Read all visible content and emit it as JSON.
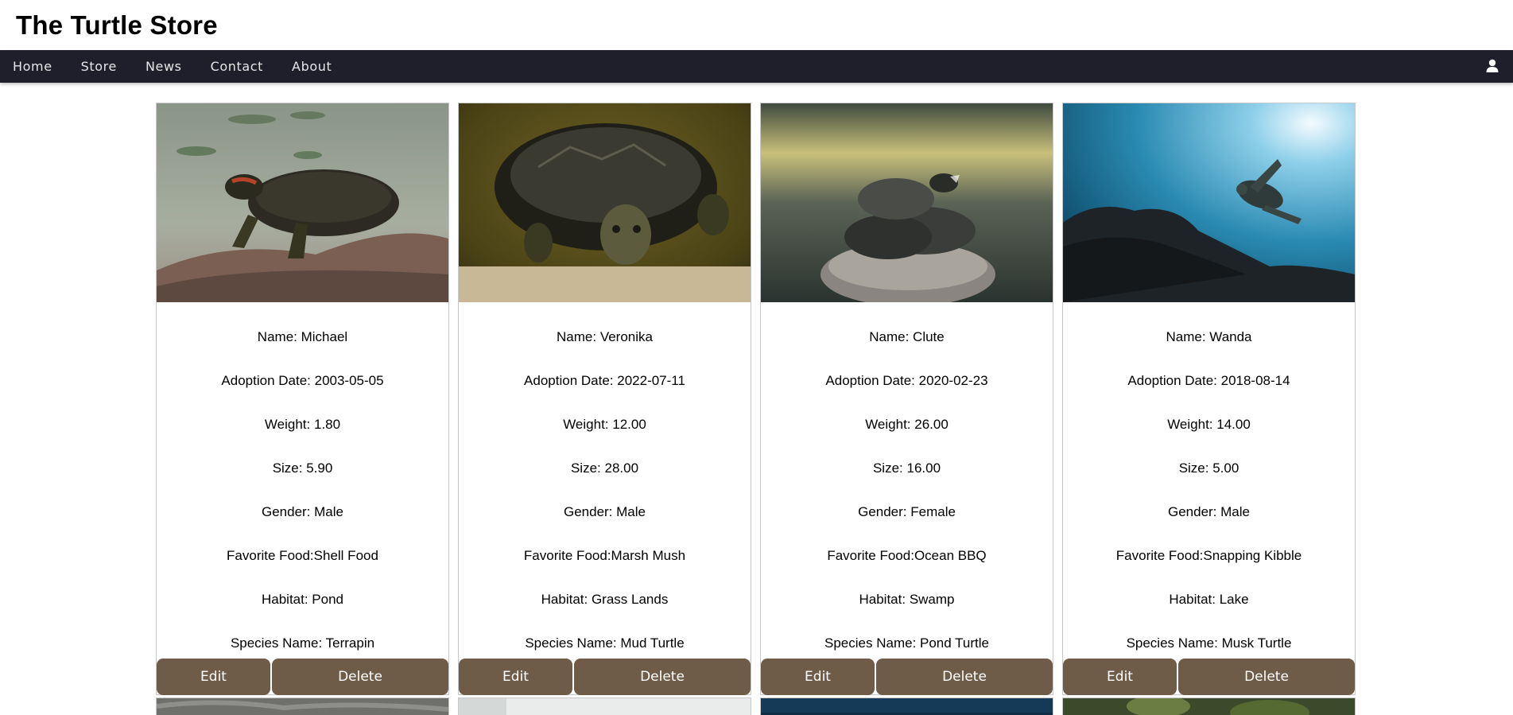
{
  "site": {
    "title": "The Turtle Store"
  },
  "nav": {
    "items": [
      "Home",
      "Store",
      "News",
      "Contact",
      "About"
    ],
    "user_icon": "user-icon"
  },
  "labels": {
    "name": "Name: ",
    "adoption_date": "Adoption Date: ",
    "weight": "Weight: ",
    "size": "Size: ",
    "gender": "Gender: ",
    "favorite_food": "Favorite Food:",
    "habitat": "Habitat: ",
    "species": "Species Name: "
  },
  "buttons": {
    "edit": "Edit",
    "delete": "Delete"
  },
  "colors": {
    "nav_bg": "#1e1f2b",
    "button_bg": "#6e5c48",
    "card_border": "#c8c8c8"
  },
  "turtles": [
    {
      "name": "Michael",
      "adoption_date": "2003-05-05",
      "weight": "1.80",
      "size": "5.90",
      "gender": "Male",
      "favorite_food": "Shell Food",
      "habitat": "Pond",
      "species": "Terrapin",
      "image": "red-eared-slider-on-rock"
    },
    {
      "name": "Veronika",
      "adoption_date": "2022-07-11",
      "weight": "12.00",
      "size": "28.00",
      "gender": "Male",
      "favorite_food": "Marsh Mush",
      "habitat": "Grass Lands",
      "species": "Mud Turtle",
      "image": "turtle-facing-camera"
    },
    {
      "name": "Clute",
      "adoption_date": "2020-02-23",
      "weight": "26.00",
      "size": "16.00",
      "gender": "Female",
      "favorite_food": "Ocean BBQ",
      "habitat": "Swamp",
      "species": "Pond Turtle",
      "image": "stacked-turtles-on-rock"
    },
    {
      "name": "Wanda",
      "adoption_date": "2018-08-14",
      "weight": "14.00",
      "size": "5.00",
      "gender": "Male",
      "favorite_food": "Snapping Kibble",
      "habitat": "Lake",
      "species": "Musk Turtle",
      "image": "sea-turtle-underwater"
    }
  ]
}
